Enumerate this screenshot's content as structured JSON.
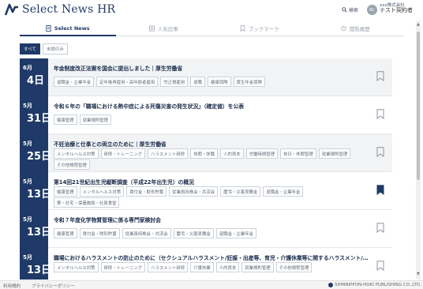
{
  "header": {
    "logo_text": "Select News HR",
    "search_label": "検索",
    "avatar_initials": "RC",
    "user_company": "xxx株式会社",
    "user_name": "テスト契約者"
  },
  "tabs": [
    {
      "label": "Select News",
      "icon": "document-icon",
      "active": true
    },
    {
      "label": "人気記事",
      "icon": "plus-box-icon",
      "active": false
    },
    {
      "label": "ブックマーク",
      "icon": "bookmark-icon",
      "active": false
    },
    {
      "label": "閲覧履歴",
      "icon": "history-icon",
      "active": false
    }
  ],
  "filters": [
    {
      "label": "すべて",
      "active": true
    },
    {
      "label": "未読のみ",
      "active": false
    }
  ],
  "articles": [
    {
      "month": "6月",
      "day": "4日",
      "title": "年金制度改正法案を国会に提出しました｜厚生労働省",
      "tag_rows": [
        [
          "退職金・企業年金",
          "定年後再雇用・高年齢者雇用",
          "労正規雇用",
          "退職",
          "健康保険",
          "厚生年金保険"
        ]
      ],
      "bookmarked": false
    },
    {
      "month": "5月",
      "day": "31日",
      "title": "令和６年の「職場における熱中症による死傷災害の発生状況」（確定値）を公表",
      "tag_rows": [
        [
          "健康管理",
          "就業規則管理"
        ]
      ],
      "bookmarked": false
    },
    {
      "month": "5月",
      "day": "25日",
      "title": "不妊治療と仕事との両立のために｜厚生労働省",
      "tag_rows": [
        [
          "メンタルヘルス対策",
          "研修・トレーニング",
          "ハラスメント研修",
          "休暇・休職",
          "人的資本",
          "労働時間管理",
          "休日・休暇管理",
          "就業規則管理"
        ],
        [
          "その他規程管理"
        ]
      ],
      "bookmarked": false
    },
    {
      "month": "5月",
      "day": "13日",
      "title": "第14回21世紀出生児縦断調査（平成22年出生児）の概況",
      "tag_rows": [
        [
          "健康管理",
          "メンタルヘルス対策",
          "賃付金・財形貯蓄",
          "従業員持株会・共済会",
          "慶弔・災害見舞金",
          "退職金・企業年金"
        ],
        [
          "寮・社宅・保養施設・社員食堂"
        ]
      ],
      "bookmarked": true
    },
    {
      "month": "5月",
      "day": "13日",
      "title": "令和７年度化学物質管理に係る専門家検討会",
      "tag_rows": [
        [
          "健康管理",
          "賃付金・財形貯蓄",
          "従業員持株会・共済会",
          "慶弔・災害見舞金",
          "退職金・企業年金"
        ]
      ],
      "bookmarked": false
    },
    {
      "month": "5月",
      "day": "13日",
      "title": "職場におけるハラスメントの防止のために（セクシュアルハラスメント/妊娠・出産等、育児・介護休業等に関するハラスメント/…",
      "tag_rows": [
        [
          "メンタルヘルス対策",
          "研修・トレーニング",
          "ハラスメント研修",
          "介護休業",
          "人的資本",
          "就業規則管理",
          "その他規程管理"
        ]
      ],
      "bookmarked": false
    }
  ],
  "footer": {
    "links": [
      "利用規約",
      "プライバシーポリシー"
    ],
    "copyright": "SHINNIPPON-HOKI PUBLISHING CO.,LTD."
  },
  "colors": {
    "navy": "#1f3a68",
    "tag_border": "#ccd2d9",
    "shaded_row": "#f1f3f5"
  }
}
